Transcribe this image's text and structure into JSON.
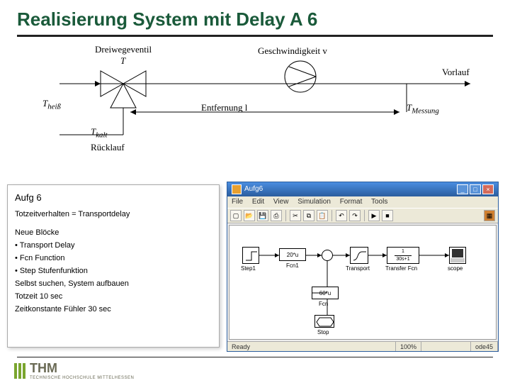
{
  "title": "Realisierung System mit Delay A 6",
  "diagram": {
    "valve_label": "Dreiwegeventil",
    "T": "T",
    "T_heiss": "Theiß",
    "T_kalt": "Tkalt",
    "ruecklauf": "Rücklauf",
    "geschwindigkeit": "Geschwindigkeit  v",
    "vorlauf": "Vorlauf",
    "entfernung": "Entfernung  l",
    "T_messung": "TMessung"
  },
  "notes": {
    "heading": "Aufg 6",
    "line1": "Totzeitverhalten  =  Transportdelay",
    "section": "Neue Blöcke",
    "b1": "• Transport Delay",
    "b2": "• Fcn Function",
    "b3": "• Step Stufenfunktion",
    "line2": "Selbst suchen, System aufbauen",
    "line3": "Totzeit 10 sec",
    "line4": "Zeitkonstante Fühler 30 sec"
  },
  "sim": {
    "title": "Aufg6",
    "menu": {
      "file": "File",
      "edit": "Edit",
      "view": "View",
      "simulation": "Simulation",
      "format": "Format",
      "tools": "Tools"
    },
    "status": {
      "ready": "Ready",
      "pct": "100%",
      "solver": "ode45"
    },
    "blocks": {
      "step1": "Step1",
      "fcn1_tx": "20*u",
      "fcn1": "Fcn1",
      "transport": "Transport",
      "xfer_expr": "1\n30s+1",
      "xfer": "Transfer Fcn",
      "scope": "scope",
      "fcn_tx": "60*u",
      "fcn": "Fcn",
      "stop": "Stop"
    }
  },
  "logo": {
    "name": "THM",
    "sub": "TECHNISCHE HOCHSCHULE MITTELHESSEN"
  }
}
